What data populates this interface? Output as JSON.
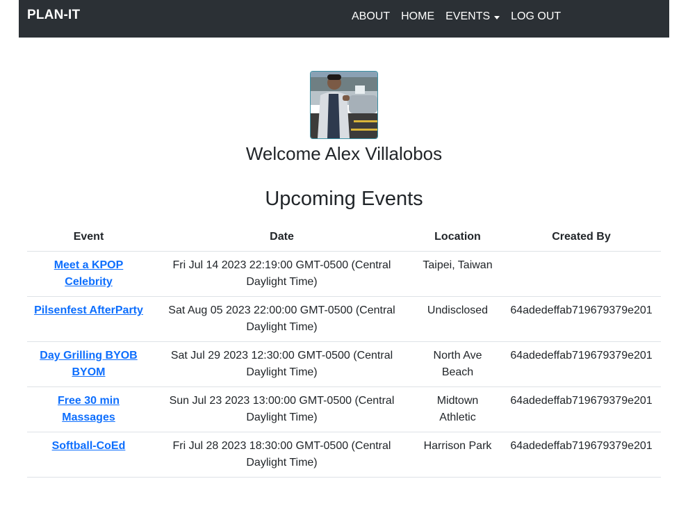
{
  "nav": {
    "brand": "PLAN-IT",
    "links": [
      "ABOUT",
      "HOME",
      "EVENTS",
      "LOG OUT"
    ]
  },
  "profile": {
    "welcome": "Welcome Alex Villalobos"
  },
  "events": {
    "title": "Upcoming Events",
    "headers": [
      "Event",
      "Date",
      "Location",
      "Created By"
    ],
    "rows": [
      {
        "event": "Meet a KPOP Celebrity",
        "date": "Fri Jul 14 2023 22:19:00 GMT-0500 (Central Daylight Time)",
        "location": "Taipei, Taiwan",
        "created_by": ""
      },
      {
        "event": "Pilsenfest AfterParty",
        "date": "Sat Aug 05 2023 22:00:00 GMT-0500 (Central Daylight Time)",
        "location": "Undisclosed",
        "created_by": "64adedeffab719679379e201"
      },
      {
        "event": "Day Grilling BYOB BYOM",
        "date": "Sat Jul 29 2023 12:30:00 GMT-0500 (Central Daylight Time)",
        "location": "North Ave Beach",
        "created_by": "64adedeffab719679379e201"
      },
      {
        "event": "Free 30 min Massages",
        "date": "Sun Jul 23 2023 13:00:00 GMT-0500 (Central Daylight Time)",
        "location": "Midtown Athletic",
        "created_by": "64adedeffab719679379e201"
      },
      {
        "event": "Softball-CoEd",
        "date": "Fri Jul 28 2023 18:30:00 GMT-0500 (Central Daylight Time)",
        "location": "Harrison Park",
        "created_by": "64adedeffab719679379e201"
      }
    ]
  }
}
